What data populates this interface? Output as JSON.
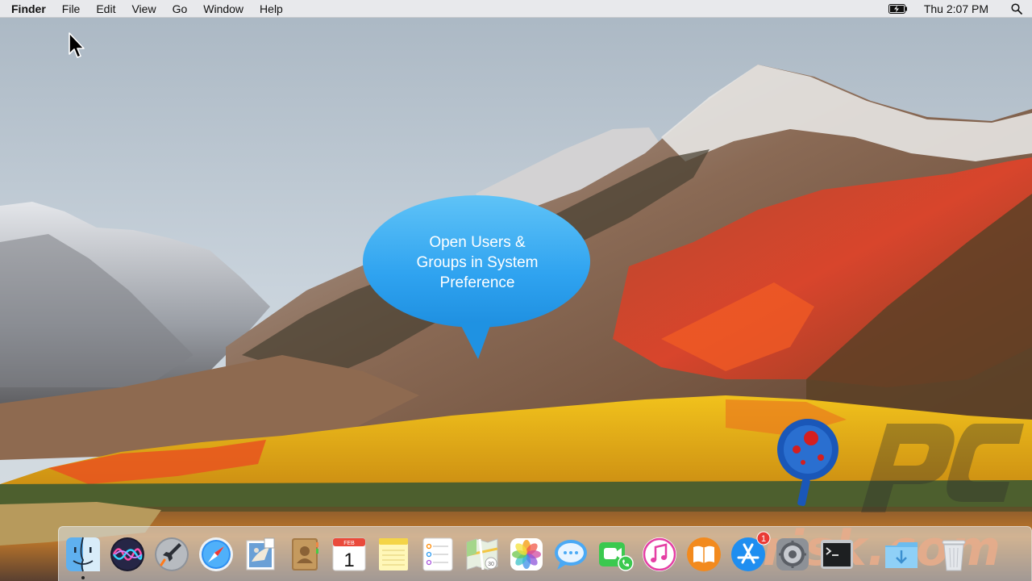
{
  "menubar": {
    "apple_icon": "apple-icon",
    "app_name": "Finder",
    "items": [
      "File",
      "Edit",
      "View",
      "Go",
      "Window",
      "Help"
    ],
    "clock": "Thu 2:07 PM",
    "battery_icon": "battery-charging-icon",
    "search_icon": "spotlight-search-icon"
  },
  "callout": {
    "text": "Open Users &\nGroups in System\nPreference",
    "color": "#35a6f0"
  },
  "watermark": {
    "text": "PC risk.com",
    "colors": {
      "orange": "#f26a1b",
      "blue": "#1a57b8",
      "red": "#d41f1f"
    }
  },
  "dock": {
    "apps": [
      {
        "name": "Finder",
        "icon": "finder-icon",
        "running": true
      },
      {
        "name": "Siri",
        "icon": "siri-icon"
      },
      {
        "name": "Launchpad",
        "icon": "launchpad-icon"
      },
      {
        "name": "Safari",
        "icon": "safari-icon"
      },
      {
        "name": "Mail",
        "icon": "mail-icon"
      },
      {
        "name": "Contacts",
        "icon": "contacts-icon"
      },
      {
        "name": "Calendar",
        "icon": "calendar-icon",
        "month": "FEB",
        "day": "1"
      },
      {
        "name": "Notes",
        "icon": "notes-icon"
      },
      {
        "name": "Reminders",
        "icon": "reminders-icon"
      },
      {
        "name": "Maps",
        "icon": "maps-icon"
      },
      {
        "name": "Photos",
        "icon": "photos-icon"
      },
      {
        "name": "Messages",
        "icon": "messages-icon"
      },
      {
        "name": "FaceTime",
        "icon": "facetime-icon"
      },
      {
        "name": "iTunes",
        "icon": "itunes-icon"
      },
      {
        "name": "iBooks",
        "icon": "ibooks-icon"
      },
      {
        "name": "App Store",
        "icon": "app-store-icon",
        "badge": "1"
      },
      {
        "name": "System Preferences",
        "icon": "system-preferences-icon"
      },
      {
        "name": "Terminal",
        "icon": "terminal-icon"
      },
      {
        "name": "Downloads",
        "icon": "downloads-folder-icon"
      },
      {
        "name": "Trash",
        "icon": "trash-icon"
      }
    ]
  }
}
